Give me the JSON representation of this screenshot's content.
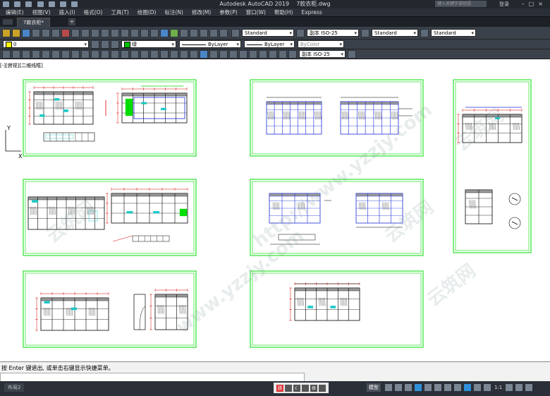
{
  "titlebar": {
    "app_title": "Autodesk AutoCAD 2019",
    "file_name": "7款衣柜.dwg",
    "search_placeholder": "键入关键字或短语",
    "login_label": "登录"
  },
  "menubar": {
    "items": [
      "编辑(E)",
      "视图(V)",
      "插入(I)",
      "格式(O)",
      "工具(T)",
      "绘图(D)",
      "标注(N)",
      "修改(M)",
      "参数(P)",
      "窗口(W)",
      "帮助(H)",
      "Express"
    ]
  },
  "tabs": {
    "document_tab": "7款衣柜*",
    "new_tab": "+"
  },
  "toolbar1": {
    "text_style": "Standard",
    "dim_style": "副本 ISO-25",
    "table_style": "Standard",
    "multileader_style": "Standard"
  },
  "toolbar2": {
    "layer": "0",
    "color": "绿",
    "linetype": "ByLayer",
    "lineweight": "ByLayer",
    "plot_style": "ByColor"
  },
  "toolbar3": {
    "dim_style": "副本 ISO-25"
  },
  "viewport": {
    "label": "[-][俯视][二维线框]",
    "ucs_y": "Y",
    "ucs_x": "X"
  },
  "watermarks": [
    "云筑网",
    "http://www.yzzjy.com",
    "云筑网",
    "www.yzzjy.com",
    "云筑网",
    "云筑网",
    "http"
  ],
  "command": {
    "history": "按 Enter 键退出, 或单击右键显示快捷菜单。",
    "input": ""
  },
  "statusbar": {
    "layout_tab": "布局2",
    "model_label": "模型",
    "scale": "1:1"
  },
  "colors": {
    "frame": "#00dd00",
    "cabinet_blue": "#1c2bd8",
    "annotation_red": "#dd0000",
    "accent_teal": "#19c8c8"
  }
}
